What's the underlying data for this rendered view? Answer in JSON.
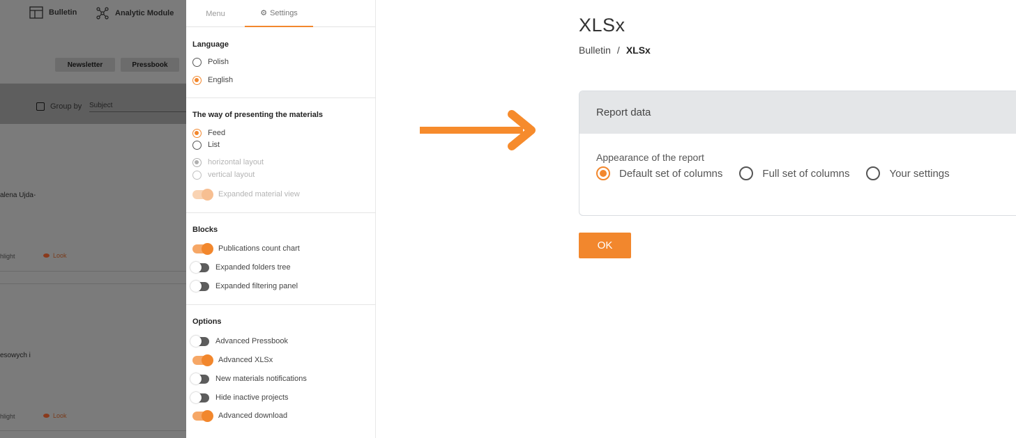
{
  "background_app": {
    "nav": {
      "bulletin_label": "Bulletin",
      "analytic_label": "Analytic Module"
    },
    "buttons": {
      "newsletter": "Newsletter",
      "pressbook": "Pressbook"
    },
    "group_by": {
      "label": "Group by",
      "value": "Subject"
    },
    "fragments": {
      "row1_text": "alena Ujda-",
      "row2_text": "esowych i",
      "highlight_text": "hlight",
      "look_label": "Look"
    }
  },
  "settings_panel": {
    "tabs": {
      "menu": "Menu",
      "settings": "Settings"
    },
    "language": {
      "title": "Language",
      "options": [
        {
          "label": "Polish",
          "selected": false
        },
        {
          "label": "English",
          "selected": true
        }
      ]
    },
    "presentation": {
      "title": "The way of presenting the materials",
      "options": [
        {
          "label": "Feed",
          "selected": true
        },
        {
          "label": "List",
          "selected": false
        }
      ],
      "layouts": [
        {
          "label": "horizontal layout",
          "selected": true
        },
        {
          "label": "vertical layout",
          "selected": false
        }
      ],
      "expanded_view": {
        "label": "Expanded material view",
        "on": true
      }
    },
    "blocks": {
      "title": "Blocks",
      "items": [
        {
          "label": "Publications count chart",
          "on": true
        },
        {
          "label": "Expanded folders tree",
          "on": false
        },
        {
          "label": "Expanded filtering panel",
          "on": false
        }
      ]
    },
    "options": {
      "title": "Options",
      "items": [
        {
          "label": "Advanced Pressbook",
          "on": false
        },
        {
          "label": "Advanced XLSx",
          "on": true
        },
        {
          "label": "New materials notifications",
          "on": false
        },
        {
          "label": "Hide inactive projects",
          "on": false
        },
        {
          "label": "Advanced download",
          "on": true
        }
      ]
    }
  },
  "report_view": {
    "title": "XLSx",
    "breadcrumb": {
      "parent": "Bulletin",
      "separator": "/",
      "current": "XLSx"
    },
    "card": {
      "header": "Report data",
      "appearance_label": "Appearance of the report",
      "options": [
        {
          "label": "Default set of columns",
          "selected": true
        },
        {
          "label": "Full set of columns",
          "selected": false
        },
        {
          "label": "Your settings",
          "selected": false
        }
      ]
    },
    "ok_label": "OK"
  },
  "colors": {
    "accent": "#f2872d",
    "overlay": "#7b7b7b",
    "card_header": "#e4e6e8"
  }
}
